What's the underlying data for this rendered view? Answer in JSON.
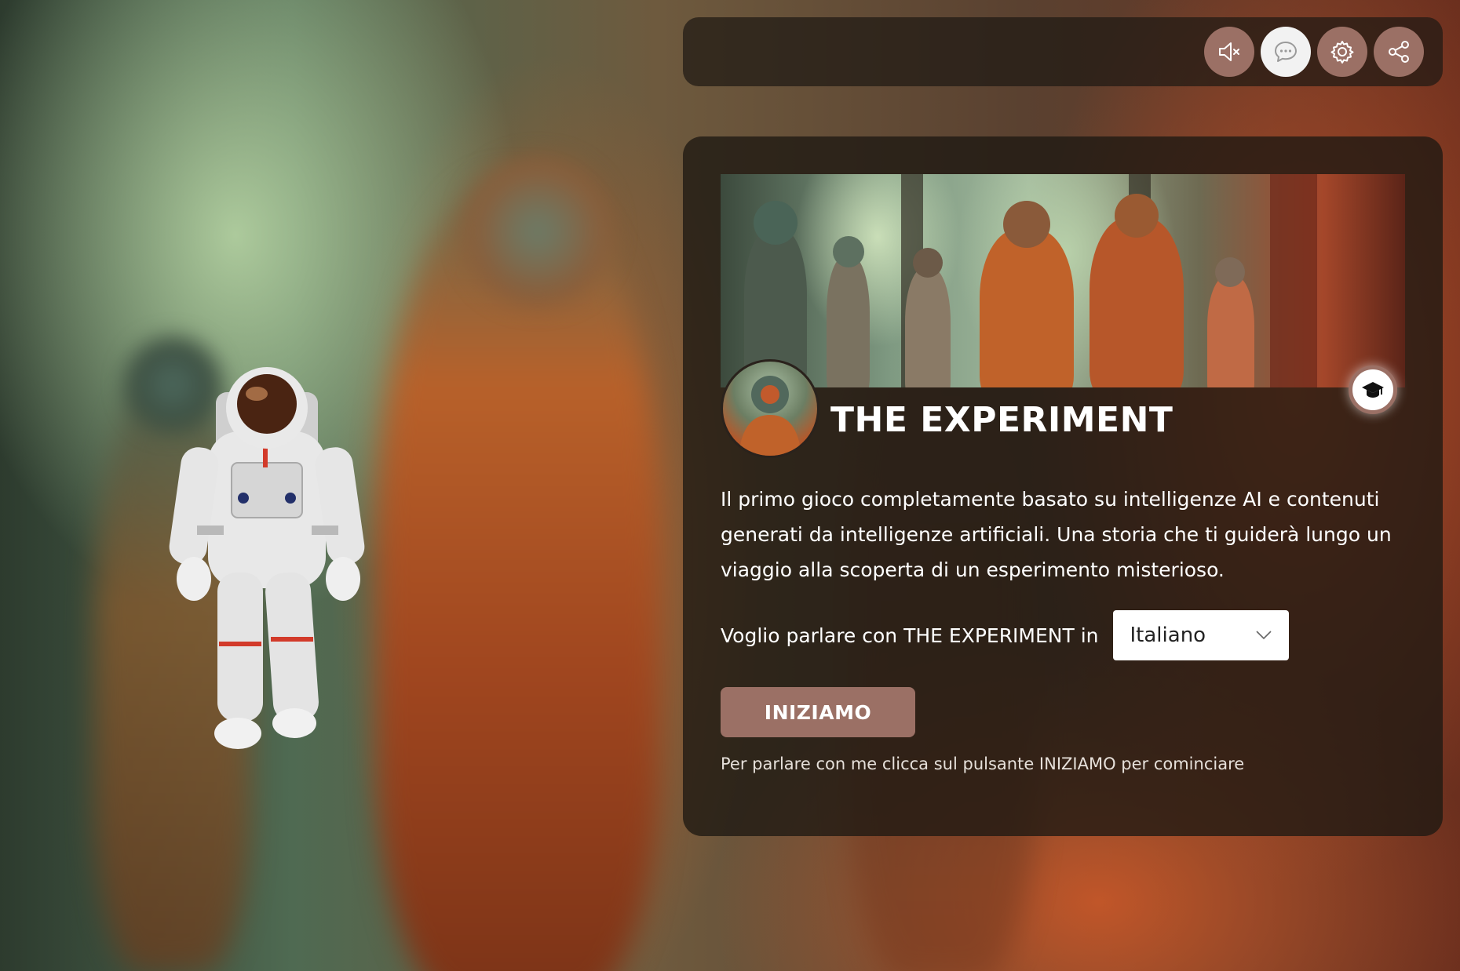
{
  "toolbar": {
    "buttons": [
      {
        "name": "mute",
        "icon": "speaker-muted-icon"
      },
      {
        "name": "chat",
        "icon": "chat-bubble-icon",
        "active": true
      },
      {
        "name": "settings",
        "icon": "gear-icon"
      },
      {
        "name": "share",
        "icon": "share-icon"
      }
    ]
  },
  "card": {
    "title": "THE EXPERIMENT",
    "description": "Il primo gioco completamente basato su intelligenze AI e contenuti generati da intelligenze artificiali. Una storia che ti guiderà lungo un viaggio alla scoperta di un esperimento misterioso.",
    "language_prompt": "Voglio parlare con THE EXPERIMENT in",
    "language_selected": "Italiano",
    "start_label": "INIZIAMO",
    "hint": "Per parlare con me clicca sul pulsante INIZIAMO per cominciare",
    "learn_icon": "graduation-cap-icon"
  },
  "colors": {
    "accent": "#9b7065",
    "card_bg": "#1e1812",
    "text": "#ffffff"
  }
}
